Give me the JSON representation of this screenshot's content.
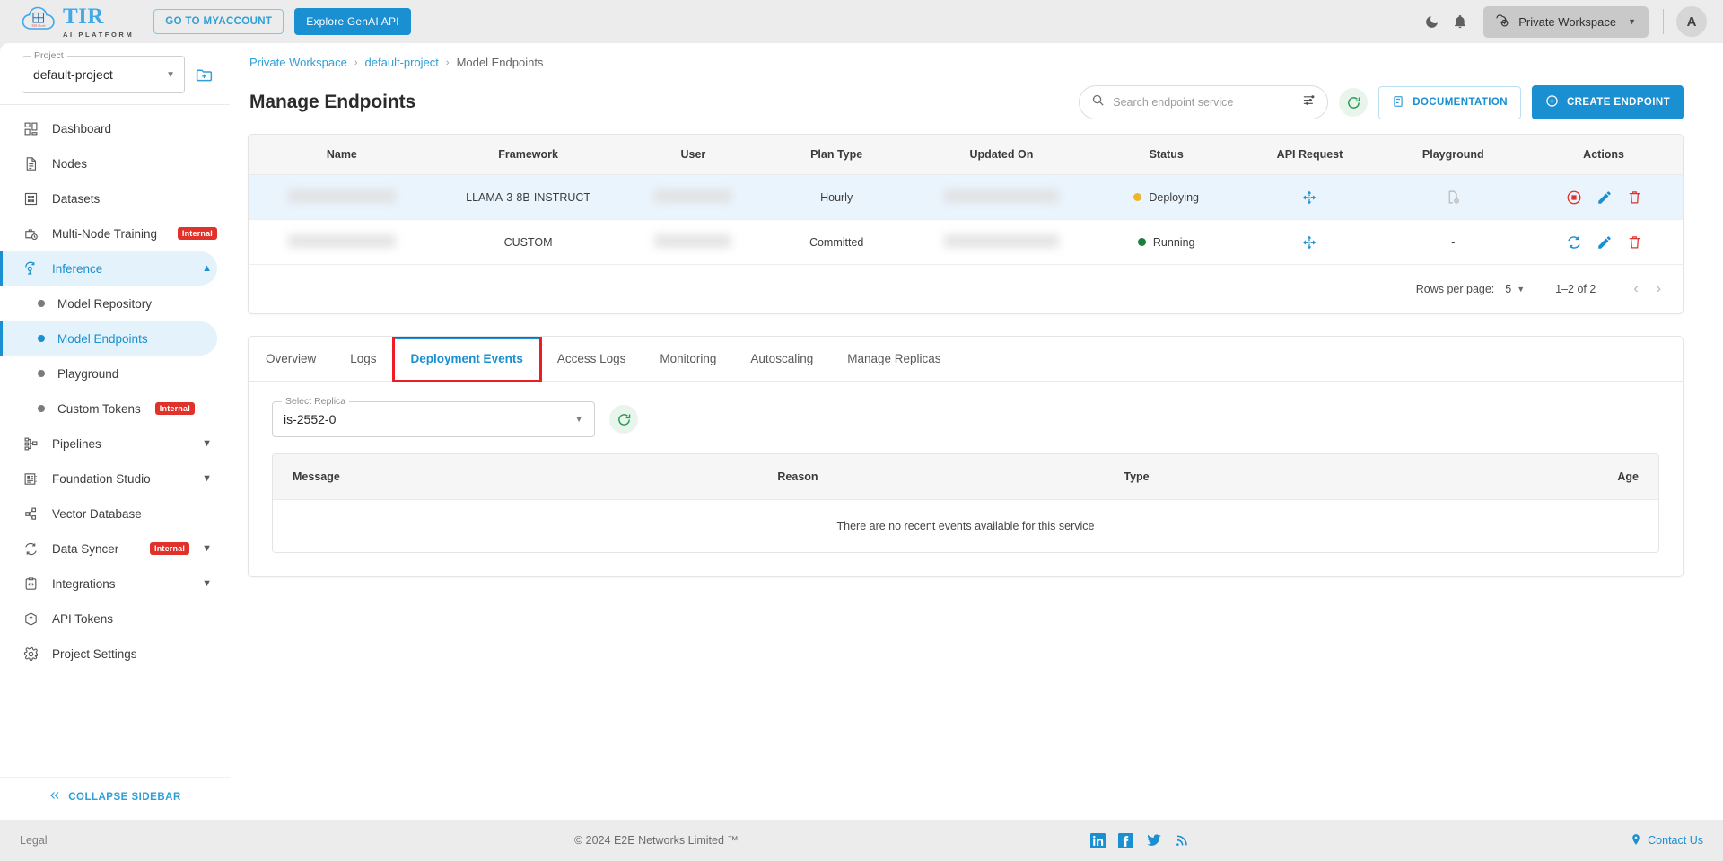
{
  "topbar": {
    "logo_title": "TIR",
    "logo_subtitle": "AI PLATFORM",
    "myaccount_label": "GO TO MYACCOUNT",
    "genai_label": "Explore GenAI API",
    "workspace_label": "Private Workspace",
    "avatar_initial": "A",
    "icons": {
      "theme": "moon-icon",
      "notifications": "bell-icon"
    }
  },
  "sidebar": {
    "project_legend": "Project",
    "project_value": "default-project",
    "items": [
      {
        "label": "Dashboard",
        "icon": "dashboard-icon",
        "type": "item"
      },
      {
        "label": "Nodes",
        "icon": "document-icon",
        "type": "item"
      },
      {
        "label": "Datasets",
        "icon": "grid-icon",
        "type": "item"
      },
      {
        "label": "Multi-Node Training",
        "icon": "briefcase-clock-icon",
        "type": "item",
        "badge": "Internal"
      },
      {
        "label": "Inference",
        "icon": "inference-icon",
        "type": "expandable",
        "expanded": true,
        "active": true
      },
      {
        "label": "Model Repository",
        "type": "sub"
      },
      {
        "label": "Model Endpoints",
        "type": "sub",
        "active": true
      },
      {
        "label": "Playground",
        "type": "sub"
      },
      {
        "label": "Custom Tokens",
        "type": "sub",
        "badge": "Internal"
      },
      {
        "label": "Pipelines",
        "icon": "pipeline-icon",
        "type": "expandable"
      },
      {
        "label": "Foundation Studio",
        "icon": "studio-icon",
        "type": "expandable"
      },
      {
        "label": "Vector Database",
        "icon": "share-nodes-icon",
        "type": "item"
      },
      {
        "label": "Data Syncer",
        "icon": "sync-icon",
        "type": "expandable",
        "badge": "Internal"
      },
      {
        "label": "Integrations",
        "icon": "code-clipboard-icon",
        "type": "expandable"
      },
      {
        "label": "API Tokens",
        "icon": "hexagon-shield-icon",
        "type": "item"
      },
      {
        "label": "Project Settings",
        "icon": "gear-icon",
        "type": "item"
      }
    ],
    "collapse_label": "COLLAPSE SIDEBAR"
  },
  "main": {
    "breadcrumb": [
      {
        "label": "Private Workspace",
        "link": true
      },
      {
        "label": "default-project",
        "link": true
      },
      {
        "label": "Model Endpoints",
        "link": false
      }
    ],
    "page_title": "Manage Endpoints",
    "search": {
      "placeholder": "Search endpoint service",
      "value": ""
    },
    "documentation_label": "DOCUMENTATION",
    "create_endpoint_label": "CREATE ENDPOINT",
    "table": {
      "columns": [
        "Name",
        "Framework",
        "User",
        "Plan Type",
        "Updated On",
        "Status",
        "API Request",
        "Playground",
        "Actions"
      ],
      "rows": [
        {
          "name": "",
          "framework": "LLAMA-3-8B-INSTRUCT",
          "user": "",
          "plan_type": "Hourly",
          "updated_on": "",
          "status": "Deploying",
          "status_color": "#f0b429",
          "playground": "icon",
          "actions": [
            "stop-icon",
            "edit-icon",
            "delete-icon"
          ],
          "highlighted": true
        },
        {
          "name": "",
          "framework": "CUSTOM",
          "user": "",
          "plan_type": "Committed",
          "updated_on": "",
          "status": "Running",
          "status_color": "#18803a",
          "playground": "-",
          "actions": [
            "restart-icon",
            "edit-icon",
            "delete-icon"
          ],
          "highlighted": false
        }
      ]
    },
    "pagination": {
      "rows_per_page_label": "Rows per page:",
      "rows_per_page_value": "5",
      "range_label": "1–2 of 2"
    },
    "tabs": [
      {
        "label": "Overview",
        "active": false
      },
      {
        "label": "Logs",
        "active": false
      },
      {
        "label": "Deployment Events",
        "active": true,
        "highlighted": true
      },
      {
        "label": "Access Logs",
        "active": false
      },
      {
        "label": "Monitoring",
        "active": false
      },
      {
        "label": "Autoscaling",
        "active": false
      },
      {
        "label": "Manage Replicas",
        "active": false
      }
    ],
    "replica": {
      "legend": "Select Replica",
      "value": "is-2552-0"
    },
    "events_table": {
      "columns": [
        "Message",
        "Reason",
        "Type",
        "Age"
      ],
      "empty_message": "There are no recent events available for this service"
    }
  },
  "footer": {
    "legal": "Legal",
    "copyright": "© 2024 E2E Networks Limited ™",
    "socials": [
      "linkedin-icon",
      "facebook-icon",
      "twitter-icon",
      "rss-icon"
    ],
    "contact": "Contact Us"
  },
  "colors": {
    "accent": "#1a8fd1",
    "danger": "#e0312a",
    "warning": "#f0b429",
    "success": "#18803a"
  }
}
